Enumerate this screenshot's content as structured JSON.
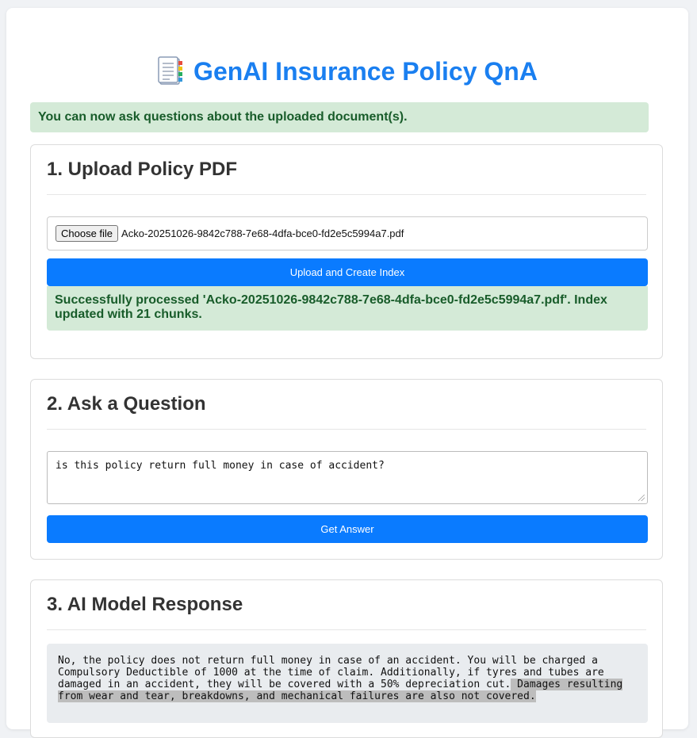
{
  "header": {
    "title": "GenAI Insurance Policy QnA",
    "icon": "document-icon"
  },
  "banner": {
    "text": "You can now ask questions about the uploaded document(s)."
  },
  "upload": {
    "heading": "1. Upload Policy PDF",
    "choose_label": "Choose file",
    "file_name": "Acko-20251026-9842c788-7e68-4dfa-bce0-fd2e5c5994a7.pdf",
    "button_label": "Upload and Create Index",
    "success_text": "Successfully processed 'Acko-20251026-9842c788-7e68-4dfa-bce0-fd2e5c5994a7.pdf'. Index updated with 21 chunks."
  },
  "ask": {
    "heading": "2. Ask a Question",
    "question_value": "is this policy return full money in case of accident?",
    "button_label": "Get Answer"
  },
  "response": {
    "heading": "3. AI Model Response",
    "answer_text": "No, the policy does not return full money in case of an accident. You will be charged a Compulsory Deductible of 1000 at the time of claim. Additionally, if tyres and tubes are damaged in an accident, they will be covered with a 50% depreciation cut.",
    "answer_highlighted": " Damages resulting from wear and tear, breakdowns, and mechanical failures are also not covered."
  },
  "colors": {
    "accent": "#0a7bff",
    "title": "#1a7ff0",
    "success_bg": "#d4ead7",
    "success_text": "#185c2a"
  }
}
